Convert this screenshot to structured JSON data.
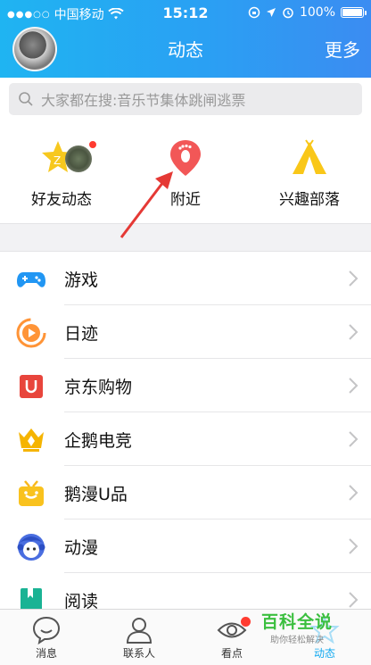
{
  "status_bar": {
    "carrier": "中国移动",
    "time": "15:12",
    "battery": "100%"
  },
  "header": {
    "title": "动态",
    "more": "更多"
  },
  "search": {
    "placeholder": "大家都在搜:音乐节集体跳闸逃票"
  },
  "quick": [
    {
      "label": "好友动态",
      "icon": "star-icon"
    },
    {
      "label": "附近",
      "icon": "location-pin-icon"
    },
    {
      "label": "兴趣部落",
      "icon": "tent-icon"
    }
  ],
  "list": [
    {
      "label": "游戏",
      "icon": "gamepad-icon"
    },
    {
      "label": "日迹",
      "icon": "play-circle-icon"
    },
    {
      "label": "京东购物",
      "icon": "shopping-bag-icon"
    },
    {
      "label": "企鹅电竞",
      "icon": "esports-crown-icon"
    },
    {
      "label": "鹅漫U品",
      "icon": "gift-tv-icon"
    },
    {
      "label": "动漫",
      "icon": "anime-face-icon"
    },
    {
      "label": "阅读",
      "icon": "book-icon"
    }
  ],
  "tabs": [
    {
      "label": "消息",
      "icon": "chat-bubble-icon"
    },
    {
      "label": "联系人",
      "icon": "contacts-icon"
    },
    {
      "label": "看点",
      "icon": "eye-icon"
    },
    {
      "label": "动态",
      "icon": "star-outline-icon"
    }
  ],
  "watermark": {
    "title": "百科全说",
    "subtitle": "助你轻松解决"
  },
  "colors": {
    "header_start": "#1fb4f2",
    "header_end": "#3b8cf2",
    "accent": "#12a9f0",
    "badge": "#ff3b30",
    "arrow": "#e53935"
  }
}
